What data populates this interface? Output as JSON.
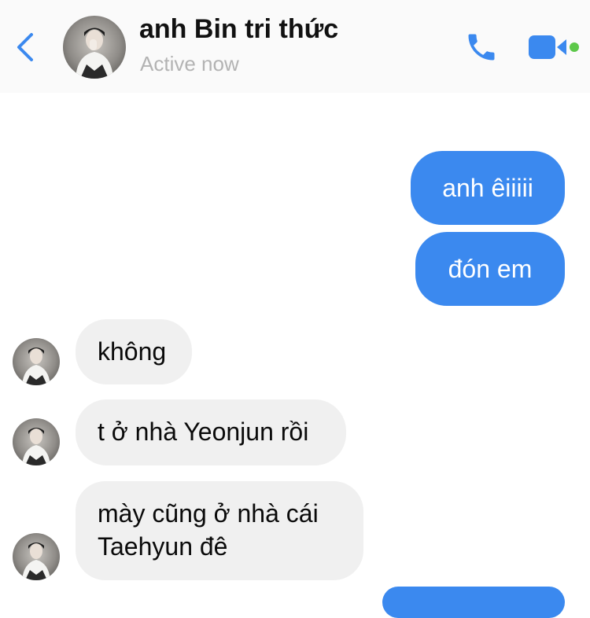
{
  "header": {
    "contact_name": "anh Bin tri thức",
    "status": "Active now",
    "back_icon": "chevron-left-icon",
    "call_icon": "phone-icon",
    "video_icon": "video-camera-icon",
    "online_dot_color": "#5dc84a",
    "accent_color": "#3b89ef"
  },
  "messages": [
    {
      "direction": "sent",
      "text": "anh êiiiii"
    },
    {
      "direction": "sent",
      "text": "đón em"
    },
    {
      "direction": "received",
      "text": "không"
    },
    {
      "direction": "received",
      "text": "t ở nhà Yeonjun rồi"
    },
    {
      "direction": "received",
      "lines": [
        "mày cũng ở nhà cái",
        "Taehyun đê"
      ]
    }
  ]
}
